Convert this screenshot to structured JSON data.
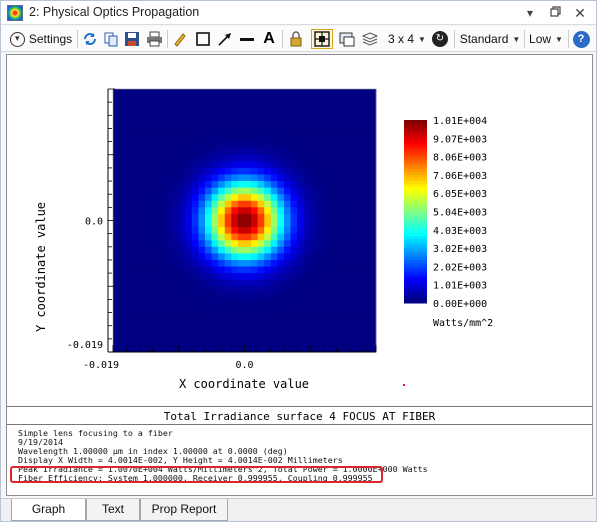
{
  "window": {
    "title": "2: Physical Optics Propagation"
  },
  "toolbar": {
    "settings_label": "Settings",
    "layout_label": "3 x 4",
    "style_label": "Standard",
    "quality_label": "Low"
  },
  "chart_data": {
    "type": "heatmap",
    "xlabel": "X coordinate value",
    "ylabel": "Y coordinate value",
    "x_ticks": [
      "-0.019",
      "0.0"
    ],
    "y_ticks": [
      "0.0",
      "-0.019"
    ],
    "xlim": [
      -0.02,
      0.02
    ],
    "ylim": [
      -0.02,
      0.02
    ],
    "peak_value": 10100,
    "peak_location": [
      0.0,
      0.0
    ],
    "distribution": "gaussian",
    "colorbar_labels": [
      "1.01E+004",
      "9.07E+003",
      "8.06E+003",
      "7.06E+003",
      "6.05E+003",
      "5.04E+003",
      "4.03E+003",
      "3.02E+003",
      "2.02E+003",
      "1.01E+003",
      "0.00E+000"
    ],
    "colorbar_units": "Watts/mm^2"
  },
  "info": {
    "title": "Total Irradiance surface 4 FOCUS AT FIBER",
    "lines": [
      "Simple lens focusing to a fiber",
      "9/19/2014",
      "Wavelength 1.00000 µm in index 1.00000 at 0.0000 (deg)",
      "Display X Width = 4.0014E-002, Y Height = 4.0014E-002 Millimeters",
      "Peak Irradiance = 1.0070E+004 Watts/Millimeters^2, Total Power = 1.0000E+000 Watts",
      "Fiber Efficiency: System 1.000000, Receiver 0.999955, Coupling 0.999955"
    ]
  },
  "tabs": [
    {
      "label": "Graph",
      "active": true
    },
    {
      "label": "Text",
      "active": false
    },
    {
      "label": "Prop Report",
      "active": false
    }
  ]
}
